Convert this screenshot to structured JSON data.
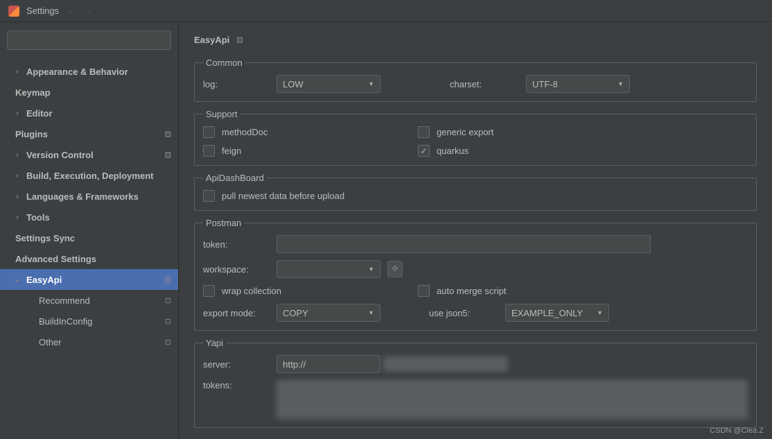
{
  "titlebar": {
    "title": "Settings"
  },
  "sidebar": {
    "search_placeholder": "",
    "items": [
      {
        "label": "Appearance & Behavior",
        "chev": "›",
        "bold": true
      },
      {
        "label": "Keymap",
        "bold": true
      },
      {
        "label": "Editor",
        "chev": "›",
        "bold": true
      },
      {
        "label": "Plugins",
        "bold": true,
        "badge": "⊡"
      },
      {
        "label": "Version Control",
        "chev": "›",
        "bold": true,
        "badge": "⊡"
      },
      {
        "label": "Build, Execution, Deployment",
        "chev": "›",
        "bold": true
      },
      {
        "label": "Languages & Frameworks",
        "chev": "›",
        "bold": true
      },
      {
        "label": "Tools",
        "chev": "›",
        "bold": true
      },
      {
        "label": "Settings Sync",
        "bold": true
      },
      {
        "label": "Advanced Settings",
        "bold": true
      },
      {
        "label": "EasyApi",
        "chev": "⌄",
        "bold": true,
        "sel": true,
        "badge": "⊡"
      },
      {
        "label": "Recommend",
        "child": true,
        "badge": "⊡"
      },
      {
        "label": "BuildInConfig",
        "child": true,
        "badge": "⊡"
      },
      {
        "label": "Other",
        "child": true,
        "badge": "⊡"
      }
    ]
  },
  "page": {
    "title": "EasyApi"
  },
  "common": {
    "legend": "Common",
    "log_label": "log:",
    "log_value": "LOW",
    "charset_label": "charset:",
    "charset_value": "UTF-8"
  },
  "support": {
    "legend": "Support",
    "methodDoc_label": "methodDoc",
    "methodDoc_checked": false,
    "genericExport_label": "generic export",
    "genericExport_checked": false,
    "feign_label": "feign",
    "feign_checked": false,
    "quarkus_label": "quarkus",
    "quarkus_checked": true
  },
  "apidash": {
    "legend": "ApiDashBoard",
    "pull_label": "pull newest data before upload",
    "pull_checked": false
  },
  "postman": {
    "legend": "Postman",
    "token_label": "token:",
    "token_value": "",
    "workspace_label": "workspace:",
    "workspace_value": "",
    "wrap_label": "wrap collection",
    "wrap_checked": false,
    "autoMerge_label": "auto merge script",
    "autoMerge_checked": false,
    "exportMode_label": "export mode:",
    "exportMode_value": "COPY",
    "useJson5_label": "use json5:",
    "useJson5_value": "EXAMPLE_ONLY"
  },
  "yapi": {
    "legend": "Yapi",
    "server_label": "server:",
    "server_value": "http://",
    "tokens_label": "tokens:"
  },
  "watermark": "CSDN @Clea.Z"
}
